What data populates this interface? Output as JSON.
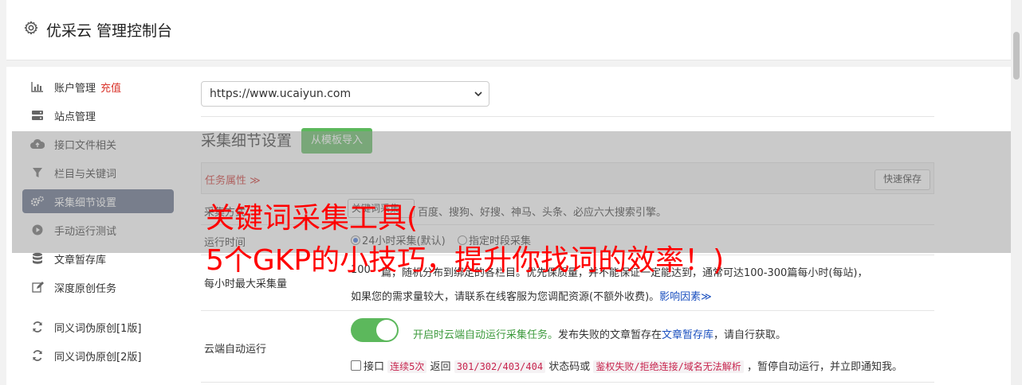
{
  "header": {
    "title": "优采云 管理控制台"
  },
  "sidebar": {
    "items": [
      {
        "label": "账户管理",
        "accent": "充值",
        "icon": "bar-chart-icon"
      },
      {
        "label": "站点管理",
        "icon": "server-icon"
      },
      {
        "label": "接口文件相关",
        "icon": "cloud-upload-icon"
      },
      {
        "label": "栏目与关键词",
        "icon": "filter-icon"
      },
      {
        "label": "采集细节设置",
        "icon": "gears-icon",
        "active": true
      },
      {
        "label": "手动运行测试",
        "icon": "play-icon"
      },
      {
        "label": "文章暂存库",
        "icon": "database-icon"
      },
      {
        "label": "深度原创任务",
        "icon": "edit-icon"
      }
    ],
    "items2": [
      {
        "label": "同义词伪原创[1版]",
        "icon": "refresh-icon"
      },
      {
        "label": "同义词伪原创[2版]",
        "icon": "refresh-icon"
      }
    ]
  },
  "site_select": {
    "value": "https://www.ucaiyun.com"
  },
  "section": {
    "title": "采集细节设置",
    "template_button": "从模板导入"
  },
  "tabs": {
    "task_props": "任务属性 ≫",
    "quick_save": "快速保存"
  },
  "rows": {
    "source": {
      "label": "采集方式",
      "select_value": "关键词采集",
      "text": "百度、搜狗、好搜、神马、头条、必应六大搜索引擎。"
    },
    "runtime": {
      "label": "运行时间",
      "opt1": "24小时采集(默认)",
      "opt2": "指定时段采集"
    },
    "max": {
      "label": "每小时最大采集量",
      "line1_value": "100",
      "line1_text": "篇，随机分布到绑定的各栏目。优先保质量，并不能保证一定能达到，通常可达100-300篇每小时(每站)，",
      "line2_text": "如果您的需求量较大，请联系在线客服为您调配资源(不额外收费)。",
      "line2_link": "影响因素≫"
    },
    "cloud": {
      "label": "云端自动运行",
      "on_text": "开启时云端自动运行采集任务。",
      "text2": "发布失败的文章暂存在",
      "link": "文章暂存库",
      "text3": "，请自行获取。",
      "cb_label": "接口",
      "code1": "连续5次",
      "text4": "返回",
      "code2": "301/302/403/404",
      "text5": "状态码或",
      "code3": "鉴权失败/拒绝连接/域名无法解析",
      "text6": "，暂停自动运行，并立即通知我。"
    }
  },
  "banner": {
    "line1": "关键词采集工具(",
    "line2": "5个GKP的小技巧，提升你找词的效率！)"
  }
}
